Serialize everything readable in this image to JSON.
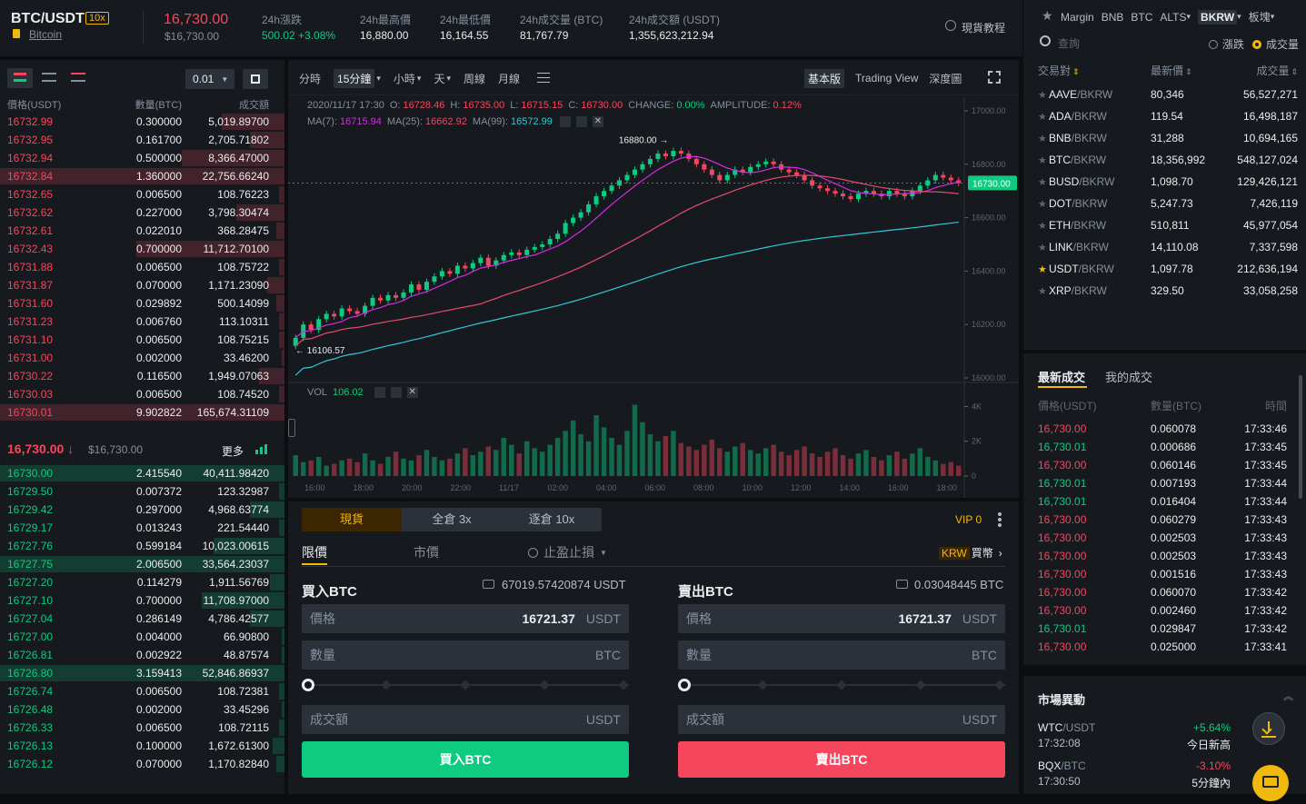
{
  "header": {
    "pair": "BTC/USDT",
    "leverage": "10x",
    "coin": "Bitcoin",
    "price": "16,730.00",
    "price_usd": "$16,730.00",
    "stats": [
      {
        "label": "24h漲跌",
        "value": "500.02 +3.08%",
        "color": "#0ecb81"
      },
      {
        "label": "24h最高價",
        "value": "16,880.00"
      },
      {
        "label": "24h最低價",
        "value": "16,164.55"
      },
      {
        "label": "24h成交量 (BTC)",
        "value": "81,767.79"
      },
      {
        "label": "24h成交額 (USDT)",
        "value": "1,355,623,212.94"
      }
    ],
    "tutorial": "現貨教程"
  },
  "orderbook": {
    "precision": "0.01",
    "cols": [
      "價格(USDT)",
      "數量(BTC)",
      "成交額"
    ],
    "asks": [
      [
        "16732.99",
        "0.300000",
        "5,019.89700",
        0.22
      ],
      [
        "16732.95",
        "0.161700",
        "2,705.71802",
        0.12
      ],
      [
        "16732.94",
        "0.500000",
        "8,366.47000",
        0.36
      ],
      [
        "16732.84",
        "1.360000",
        "22,756.66240",
        1.0
      ],
      [
        "16732.65",
        "0.006500",
        "108.76223",
        0.02
      ],
      [
        "16732.62",
        "0.227000",
        "3,798.30474",
        0.17
      ],
      [
        "16732.61",
        "0.022010",
        "368.28475",
        0.03
      ],
      [
        "16732.43",
        "0.700000",
        "11,712.70100",
        0.52
      ],
      [
        "16731.88",
        "0.006500",
        "108.75722",
        0.02
      ],
      [
        "16731.87",
        "0.070000",
        "1,171.23090",
        0.06
      ],
      [
        "16731.60",
        "0.029892",
        "500.14099",
        0.03
      ],
      [
        "16731.23",
        "0.006760",
        "113.10311",
        0.02
      ],
      [
        "16731.10",
        "0.006500",
        "108.75215",
        0.02
      ],
      [
        "16731.00",
        "0.002000",
        "33.46200",
        0.01
      ],
      [
        "16730.22",
        "0.116500",
        "1,949.07063",
        0.09
      ],
      [
        "16730.03",
        "0.006500",
        "108.74520",
        0.02
      ],
      [
        "16730.01",
        "9.902822",
        "165,674.31109",
        1.0
      ]
    ],
    "last": "16,730.00",
    "last_arrow": "↓",
    "last_usd": "$16,730.00",
    "more": "更多",
    "bids": [
      [
        "16730.00",
        "2.415540",
        "40,411.98420",
        1.0
      ],
      [
        "16729.50",
        "0.007372",
        "123.32987",
        0.02
      ],
      [
        "16729.42",
        "0.297000",
        "4,968.63774",
        0.12
      ],
      [
        "16729.17",
        "0.013243",
        "221.54440",
        0.02
      ],
      [
        "16727.76",
        "0.599184",
        "10,023.00615",
        0.25
      ],
      [
        "16727.75",
        "2.006500",
        "33,564.23037",
        1.0
      ],
      [
        "16727.20",
        "0.114279",
        "1,911.56769",
        0.05
      ],
      [
        "16727.10",
        "0.700000",
        "11,708.97000",
        0.29
      ],
      [
        "16727.04",
        "0.286149",
        "4,786.42577",
        0.12
      ],
      [
        "16727.00",
        "0.004000",
        "66.90800",
        0.01
      ],
      [
        "16726.81",
        "0.002922",
        "48.87574",
        0.01
      ],
      [
        "16726.80",
        "3.159413",
        "52,846.86937",
        1.0
      ],
      [
        "16726.74",
        "0.006500",
        "108.72381",
        0.02
      ],
      [
        "16726.48",
        "0.002000",
        "33.45296",
        0.01
      ],
      [
        "16726.33",
        "0.006500",
        "108.72115",
        0.02
      ],
      [
        "16726.13",
        "0.100000",
        "1,672.61300",
        0.04
      ],
      [
        "16726.12",
        "0.070000",
        "1,170.82840",
        0.03
      ]
    ]
  },
  "chart": {
    "intervals": [
      "分時",
      "15分鐘",
      "小時",
      "天",
      "周線",
      "月線"
    ],
    "views": [
      "基本版",
      "Trading View",
      "深度圖"
    ],
    "info": {
      "date": "2020/11/17 17:30",
      "o": "16728.46",
      "h": "16735.00",
      "l": "16715.15",
      "c": "16730.00",
      "change": "0.00%",
      "amplitude": "0.12%"
    },
    "ma": {
      "ma7": "16715.94",
      "ma25": "16662.92",
      "ma99": "16572.99"
    },
    "vol": "106.02",
    "high_mark": "16880.00",
    "low_mark": "16106.57",
    "current": "16730.00",
    "yticks": [
      "17000.00",
      "16800.00",
      "16600.00",
      "16400.00",
      "16200.00",
      "16000.00"
    ],
    "vticks": [
      "4K",
      "2K",
      "0"
    ],
    "xticks": [
      "16:00",
      "18:00",
      "20:00",
      "22:00",
      "11/17",
      "02:00",
      "04:00",
      "06:00",
      "08:00",
      "10:00",
      "12:00",
      "14:00",
      "16:00",
      "18:00"
    ],
    "ylim": [
      16000,
      17000
    ],
    "closes": [
      16150,
      16200,
      16180,
      16220,
      16240,
      16230,
      16260,
      16250,
      16240,
      16270,
      16300,
      16290,
      16310,
      16300,
      16320,
      16350,
      16330,
      16360,
      16380,
      16400,
      16390,
      16420,
      16410,
      16430,
      16450,
      16420,
      16440,
      16460,
      16470,
      16460,
      16480,
      16490,
      16500,
      16520,
      16540,
      16580,
      16600,
      16620,
      16650,
      16680,
      16700,
      16720,
      16740,
      16760,
      16780,
      16800,
      16820,
      16840,
      16830,
      16850,
      16840,
      16820,
      16800,
      16780,
      16760,
      16740,
      16760,
      16780,
      16770,
      16790,
      16800,
      16810,
      16800,
      16780,
      16770,
      16760,
      16740,
      16720,
      16710,
      16700,
      16690,
      16680,
      16670,
      16690,
      16700,
      16690,
      16680,
      16700,
      16690,
      16680,
      16700,
      16720,
      16740,
      16760,
      16750,
      16740,
      16730
    ],
    "vols": [
      1200,
      800,
      900,
      1100,
      600,
      700,
      900,
      1000,
      800,
      1300,
      900,
      700,
      1100,
      1400,
      1000,
      900,
      1200,
      1500,
      1100,
      900,
      1000,
      1300,
      1600,
      1200,
      1400,
      1700,
      1500,
      2200,
      1800,
      1300,
      2000,
      1600,
      1400,
      1800,
      2200,
      2600,
      3200,
      2400,
      2000,
      3500,
      2800,
      2200,
      1800,
      2600,
      4100,
      3100,
      2400,
      2000,
      2300,
      2600,
      1900,
      1700,
      1500,
      1800,
      2100,
      1600,
      1400,
      1700,
      1900,
      1500,
      1300,
      1600,
      1800,
      1400,
      1200,
      1500,
      1700,
      1300,
      1100,
      1400,
      1600,
      1200,
      1000,
      1300,
      1500,
      1100,
      900,
      1200,
      1400,
      1000,
      1300,
      1600,
      1100,
      900,
      700,
      800,
      600
    ]
  },
  "trade": {
    "modes": [
      "現貨",
      "全倉 3x",
      "逐倉 10x"
    ],
    "vip": "VIP 0",
    "types": [
      "限價",
      "市價",
      "止盈止損"
    ],
    "krw": "KRW",
    "krw_label": "買幣",
    "buy": {
      "title": "買入BTC",
      "avail": "67019.57420874 USDT",
      "price_label": "價格",
      "price": "16721.37",
      "price_unit": "USDT",
      "amount_label": "數量",
      "amount_unit": "BTC",
      "total_label": "成交額",
      "total_unit": "USDT",
      "btn": "買入BTC"
    },
    "sell": {
      "title": "賣出BTC",
      "avail": "0.03048445 BTC",
      "price_label": "價格",
      "price": "16721.37",
      "price_unit": "USDT",
      "amount_label": "數量",
      "amount_unit": "BTC",
      "total_label": "成交額",
      "total_unit": "USDT",
      "btn": "賣出BTC"
    }
  },
  "markets": {
    "tabs": [
      "Margin",
      "BNB",
      "BTC",
      "ALTS",
      "BKRW",
      "板塊"
    ],
    "search": "查詢",
    "radio1": "漲跌",
    "radio2": "成交量",
    "cols": [
      "交易對",
      "最新價",
      "成交量"
    ],
    "rows": [
      [
        "AAVE",
        "/BKRW",
        "80,346",
        "56,527,271",
        false
      ],
      [
        "ADA",
        "/BKRW",
        "119.54",
        "16,498,187",
        false
      ],
      [
        "BNB",
        "/BKRW",
        "31,288",
        "10,694,165",
        false
      ],
      [
        "BTC",
        "/BKRW",
        "18,356,992",
        "548,127,024",
        false
      ],
      [
        "BUSD",
        "/BKRW",
        "1,098.70",
        "129,426,121",
        false
      ],
      [
        "DOT",
        "/BKRW",
        "5,247.73",
        "7,426,119",
        false
      ],
      [
        "ETH",
        "/BKRW",
        "510,811",
        "45,977,054",
        false
      ],
      [
        "LINK",
        "/BKRW",
        "14,110.08",
        "7,337,598",
        false
      ],
      [
        "USDT",
        "/BKRW",
        "1,097.78",
        "212,636,194",
        true
      ],
      [
        "XRP",
        "/BKRW",
        "329.50",
        "33,058,258",
        false
      ]
    ]
  },
  "trades": {
    "tabs": [
      "最新成交",
      "我的成交"
    ],
    "cols": [
      "價格(USDT)",
      "數量(BTC)",
      "時間"
    ],
    "rows": [
      [
        "16,730.00",
        "0.060078",
        "17:33:46",
        "r"
      ],
      [
        "16,730.01",
        "0.000686",
        "17:33:45",
        "g"
      ],
      [
        "16,730.00",
        "0.060146",
        "17:33:45",
        "r"
      ],
      [
        "16,730.01",
        "0.007193",
        "17:33:44",
        "g"
      ],
      [
        "16,730.01",
        "0.016404",
        "17:33:44",
        "g"
      ],
      [
        "16,730.00",
        "0.060279",
        "17:33:43",
        "r"
      ],
      [
        "16,730.00",
        "0.002503",
        "17:33:43",
        "r"
      ],
      [
        "16,730.00",
        "0.002503",
        "17:33:43",
        "r"
      ],
      [
        "16,730.00",
        "0.001516",
        "17:33:43",
        "r"
      ],
      [
        "16,730.00",
        "0.060070",
        "17:33:42",
        "r"
      ],
      [
        "16,730.00",
        "0.002460",
        "17:33:42",
        "r"
      ],
      [
        "16,730.01",
        "0.029847",
        "17:33:42",
        "g"
      ],
      [
        "16,730.00",
        "0.025000",
        "17:33:41",
        "r"
      ]
    ]
  },
  "movers": {
    "title": "市場異動",
    "rows": [
      {
        "pair": "WTC",
        "quote": "/USDT",
        "time": "17:32:08",
        "pct": "+5.64%",
        "desc": "今日新高",
        "color": "#0ecb81"
      },
      {
        "pair": "BQX",
        "quote": "/BTC",
        "time": "17:30:50",
        "pct": "-3.10%",
        "desc": "5分鐘內",
        "color": "#f6465d"
      }
    ]
  }
}
